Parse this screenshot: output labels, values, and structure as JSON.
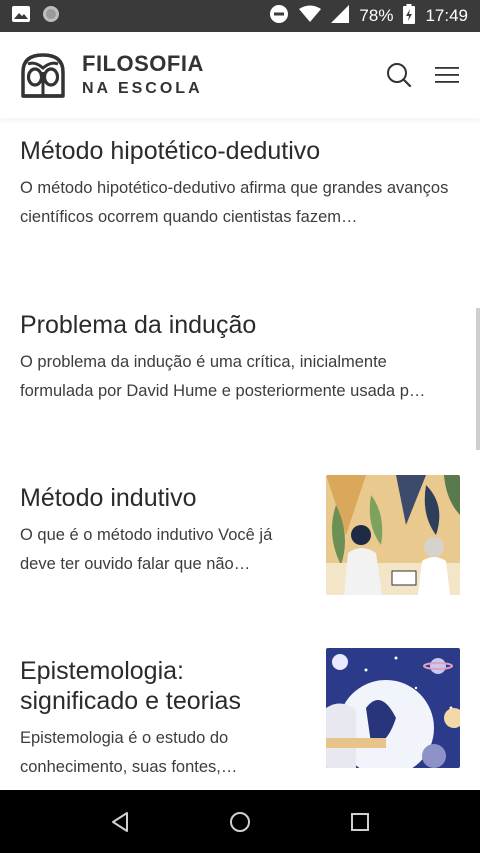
{
  "status_bar": {
    "battery_percent": "78%",
    "time": "17:49",
    "icons": [
      "image-icon",
      "circle-notification-icon",
      "do-not-disturb-icon",
      "wifi-icon",
      "signal-icon",
      "battery-charging-icon"
    ]
  },
  "header": {
    "brand_top": "FILOSOFIA",
    "brand_bottom": "NA ESCOLA",
    "icons": [
      "owl-logo-icon",
      "search-icon",
      "menu-icon"
    ]
  },
  "articles": [
    {
      "title": "Método hipotético-dedutivo",
      "excerpt": "O método hipotético-dedutivo afirma que grandes avanços científicos ocorrem quando cientistas fazem…"
    },
    {
      "title": "Problema da indução",
      "excerpt": "O problema da indução é uma crítica, inicialmente formulada por David Hume e posteriormente usada p…"
    },
    {
      "title": "Método indutivo",
      "excerpt": "O que é o método indutivo Você já deve ter ouvido falar que não…",
      "image": "scientists-plants-illustration"
    },
    {
      "title": "Epistemologia: significado e teorias",
      "excerpt": "Epistemologia é o estudo do conhecimento, suas fontes,…",
      "image": "thinker-moon-illustration"
    }
  ],
  "nav_bar": {
    "icons": [
      "back-triangle-icon",
      "home-circle-icon",
      "recents-square-icon"
    ]
  }
}
